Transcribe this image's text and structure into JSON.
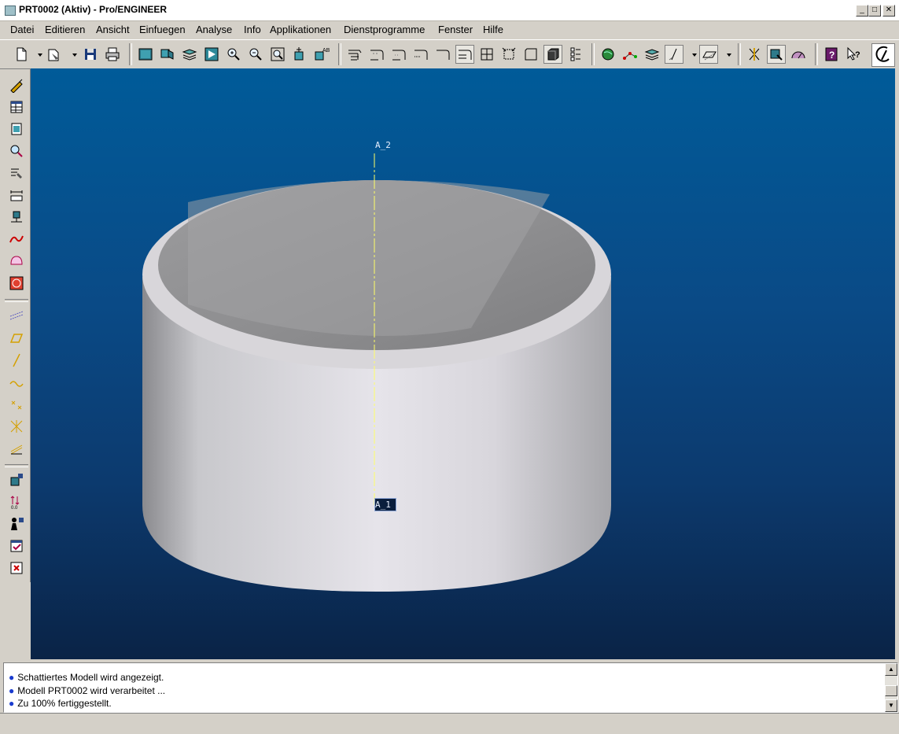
{
  "window": {
    "title": "PRT0002 (Aktiv) - Pro/ENGINEER",
    "minimize": "_",
    "maximize": "□",
    "close": "✕"
  },
  "menu": [
    {
      "label": "Datei",
      "key": "D"
    },
    {
      "label": "Editieren",
      "key": "E"
    },
    {
      "label": "Ansicht",
      "key": "A"
    },
    {
      "label": "Einfuegen",
      "key": "i"
    },
    {
      "label": "Analyse",
      "key": "A"
    },
    {
      "label": "Info",
      "key": "I"
    },
    {
      "label": "Applikationen",
      "key": "A"
    },
    {
      "label": "Dienstprogramme",
      "key": "D"
    },
    {
      "label": "Fenster",
      "key": "F"
    },
    {
      "label": "Hilfe",
      "key": "H"
    }
  ],
  "viewport": {
    "axis_top_label": "A_2",
    "axis_bottom_label": "A_1",
    "colors": {
      "axis": "#ffff66",
      "model": "#c8c8cc",
      "label_bg": "#0a1e3c"
    }
  },
  "messages": [
    "Schattiertes Modell wird angezeigt.",
    "Modell PRT0002 wird verarbeitet ...",
    "Zu 100% fertiggestellt."
  ],
  "icons": {
    "toolbar": [
      "new-file-icon",
      "dropdown-icon",
      "open-file-icon",
      "dropdown-icon",
      "save-icon",
      "print-icon",
      "repaint-icon",
      "orient-icon",
      "layers-icon",
      "saved-views-icon",
      "zoom-in-icon",
      "zoom-out-icon",
      "refit-icon",
      "spin-center-icon",
      "named-views-icon",
      "wireframe-icon",
      "hidden-line-icon",
      "no-hidden-icon",
      "tangent-edge-icon",
      "edge-display-icon",
      "shaded-icon",
      "shaded-edges-icon",
      "shading-icon",
      "model-tree-icon",
      "datum-planes-icon",
      "datum-axes-icon",
      "datum-points-icon",
      "coord-sys-icon",
      "datum-display-icon",
      "model-analysis-icon",
      "datum-plane-tool-icon",
      "hole-tool-icon",
      "measure-icon",
      "context-help-icon",
      "whats-this-icon",
      "pro-logo-icon"
    ],
    "left": [
      "sketch-icon",
      "table-icon",
      "part-icon",
      "inspect-icon",
      "edit-icon",
      "dimension-icon",
      "attach-icon",
      "curve-icon",
      "surface-icon",
      "analysis-icon",
      "datum-curve-icon",
      "plane-icon",
      "axis-icon",
      "spline-icon",
      "point-icon",
      "csys-icon",
      "offset-icon",
      "feature-icon",
      "parameter-icon",
      "family-icon",
      "accept-icon",
      "cancel-icon"
    ]
  }
}
